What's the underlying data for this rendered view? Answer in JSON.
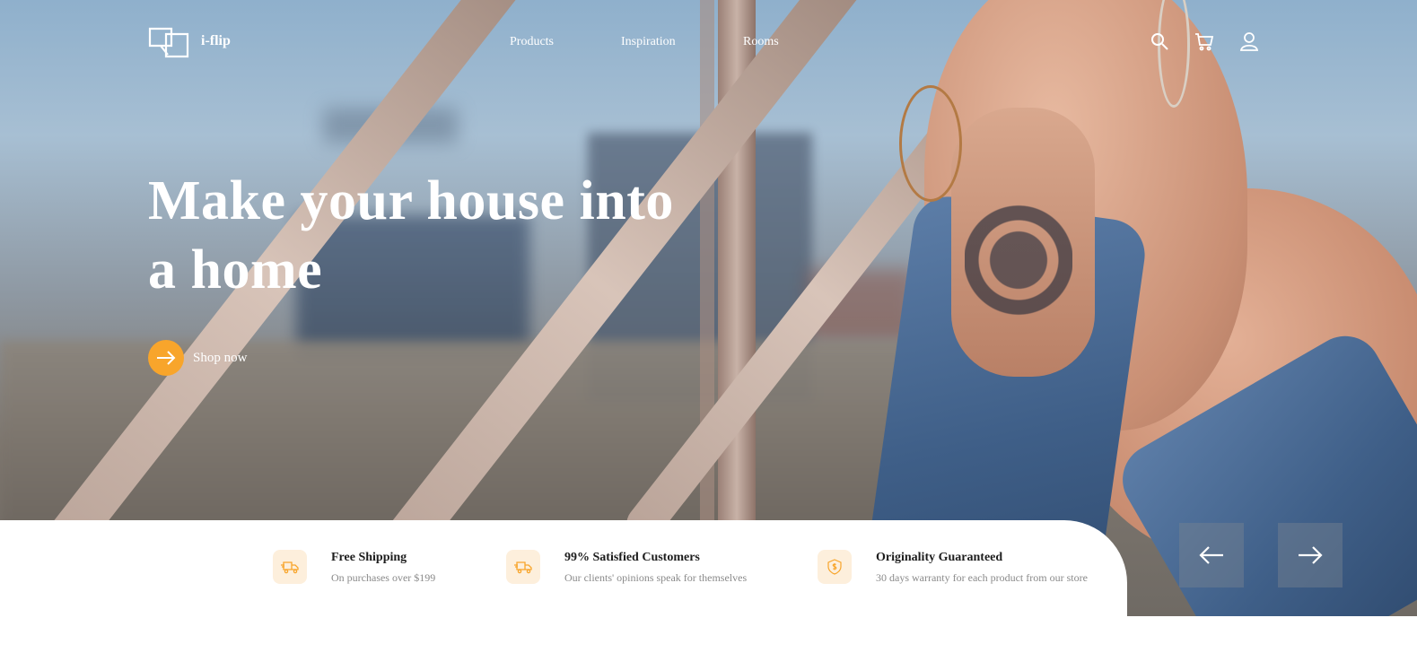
{
  "header": {
    "brand": "i-flip",
    "nav": [
      "Products",
      "Inspiration",
      "Rooms"
    ],
    "icons": [
      "search-icon",
      "cart-icon",
      "user-icon"
    ]
  },
  "hero": {
    "headline_line1": "Make your house into",
    "headline_line2": "a home",
    "cta_label": "Shop now",
    "accent_color": "#f8a52b"
  },
  "features": [
    {
      "icon": "truck-icon",
      "title": "Free Shipping",
      "subtitle": "On purchases over $199"
    },
    {
      "icon": "truck-icon",
      "title": "99% Satisfied Customers",
      "subtitle": "Our clients' opinions speak for themselves"
    },
    {
      "icon": "shield-dollar-icon",
      "title": "Originality Guaranteed",
      "subtitle": "30 days warranty for each product from our store"
    }
  ],
  "slider": {
    "prev_icon": "arrow-left-icon",
    "next_icon": "arrow-right-icon"
  }
}
